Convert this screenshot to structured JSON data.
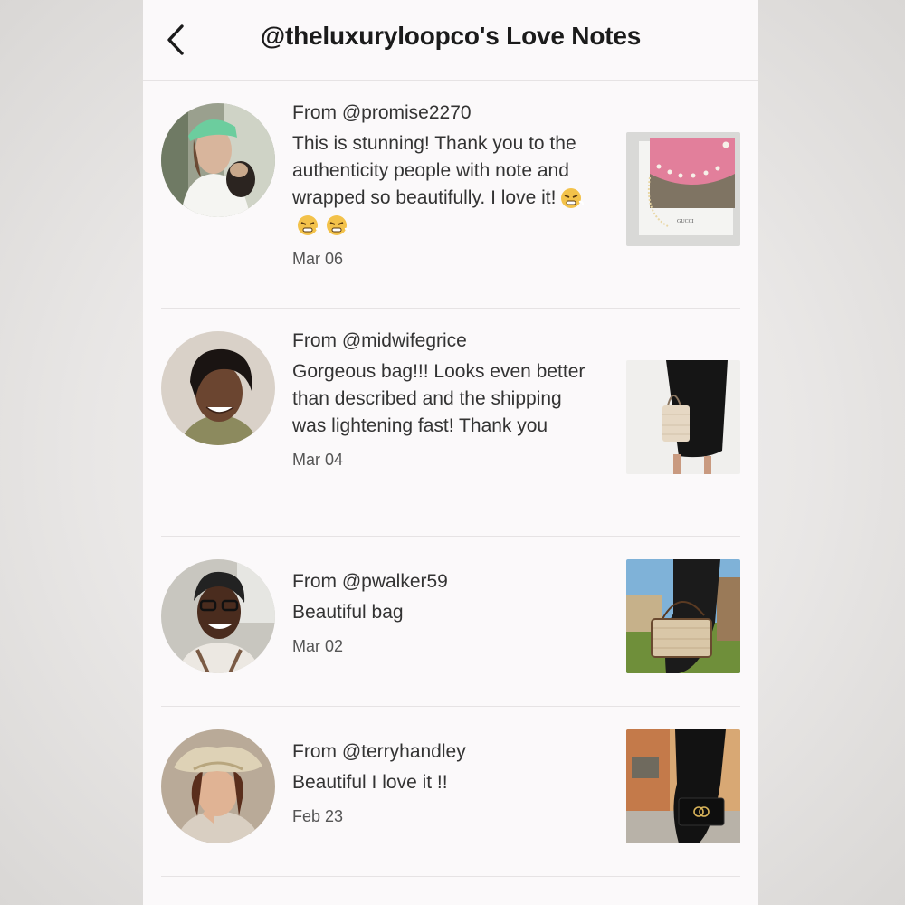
{
  "header": {
    "title": "@theluxuryloopco's Love Notes"
  },
  "notes": [
    {
      "from": "From @promise2270",
      "text": "This is stunning! Thank you to the authenticity people with note and wrapped so beautifully. I love it!",
      "date": "Mar 06",
      "emoji_count": 3,
      "thumb_brand": "GUCCI"
    },
    {
      "from": "From @midwifegrice",
      "text": "Gorgeous bag!!! Looks even better than described and the shipping was lightening fast! Thank you",
      "date": "Mar 04"
    },
    {
      "from": "From @pwalker59",
      "text": "Beautiful bag",
      "date": "Mar 02"
    },
    {
      "from": "From @terryhandley",
      "text": "Beautiful I love it !!",
      "date": "Feb 23"
    }
  ]
}
